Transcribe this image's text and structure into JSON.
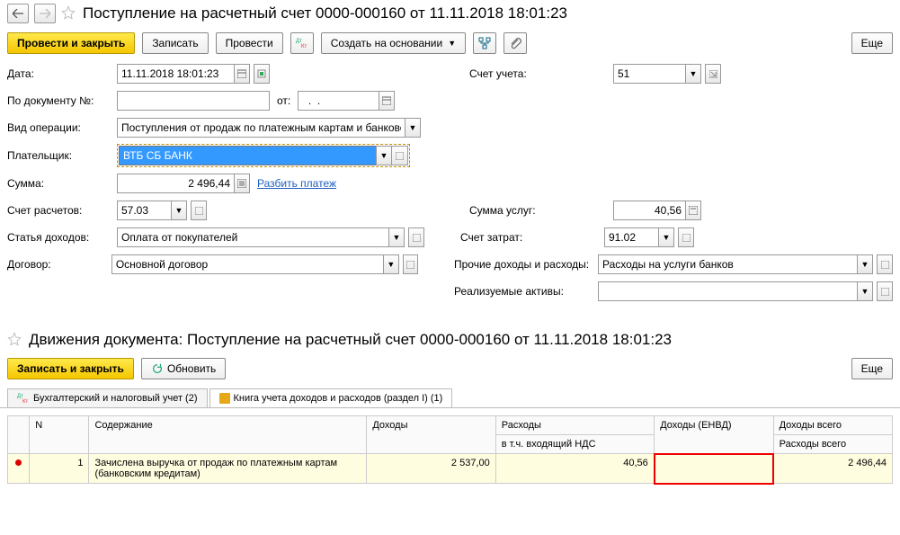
{
  "header": {
    "title": "Поступление на расчетный счет 0000-000160 от 11.11.2018 18:01:23"
  },
  "toolbar": {
    "post_close": "Провести и закрыть",
    "save": "Записать",
    "post": "Провести",
    "create_based": "Создать на основании",
    "more": "Еще"
  },
  "form": {
    "date_label": "Дата:",
    "date_value": "11.11.2018 18:01:23",
    "account_label": "Счет учета:",
    "account_value": "51",
    "docnum_label": "По документу №:",
    "docnum_value": "",
    "from_label": "от:",
    "from_value": "  .  .",
    "optype_label": "Вид операции:",
    "optype_value": "Поступления от продаж по платежным картам и банковским кре",
    "payer_label": "Плательщик:",
    "payer_value": "ВТБ СБ БАНК",
    "sum_label": "Сумма:",
    "sum_value": "2 496,44",
    "split_link": "Разбить платеж",
    "settle_account_label": "Счет расчетов:",
    "settle_account_value": "57.03",
    "income_item_label": "Статья доходов:",
    "income_item_value": "Оплата от покупателей",
    "contract_label": "Договор:",
    "contract_value": "Основной договор",
    "service_sum_label": "Сумма услуг:",
    "service_sum_value": "40,56",
    "expense_account_label": "Счет затрат:",
    "expense_account_value": "91.02",
    "other_label": "Прочие доходы и расходы:",
    "other_value": "Расходы на услуги банков",
    "assets_label": "Реализуемые активы:",
    "assets_value": ""
  },
  "movements": {
    "title": "Движения документа: Поступление на расчетный счет 0000-000160 от 11.11.2018 18:01:23",
    "save_close": "Записать и закрыть",
    "refresh": "Обновить",
    "more": "Еще",
    "tab1": "Бухгалтерский и налоговый учет (2)",
    "tab2": "Книга учета доходов и расходов (раздел I) (1)",
    "columns": {
      "n": "N",
      "content": "Содержание",
      "income": "Доходы",
      "expenses": "Расходы",
      "income_envd": "Доходы (ЕНВД)",
      "income_total": "Доходы всего",
      "vat_incl": "в т.ч. входящий НДС",
      "expenses_total": "Расходы всего"
    },
    "row": {
      "n": "1",
      "content": "Зачислена выручка от продаж по платежным картам (банковским кредитам)",
      "income": "2 537,00",
      "expenses": "40,56",
      "income_envd": "",
      "income_total": "2 496,44"
    }
  }
}
